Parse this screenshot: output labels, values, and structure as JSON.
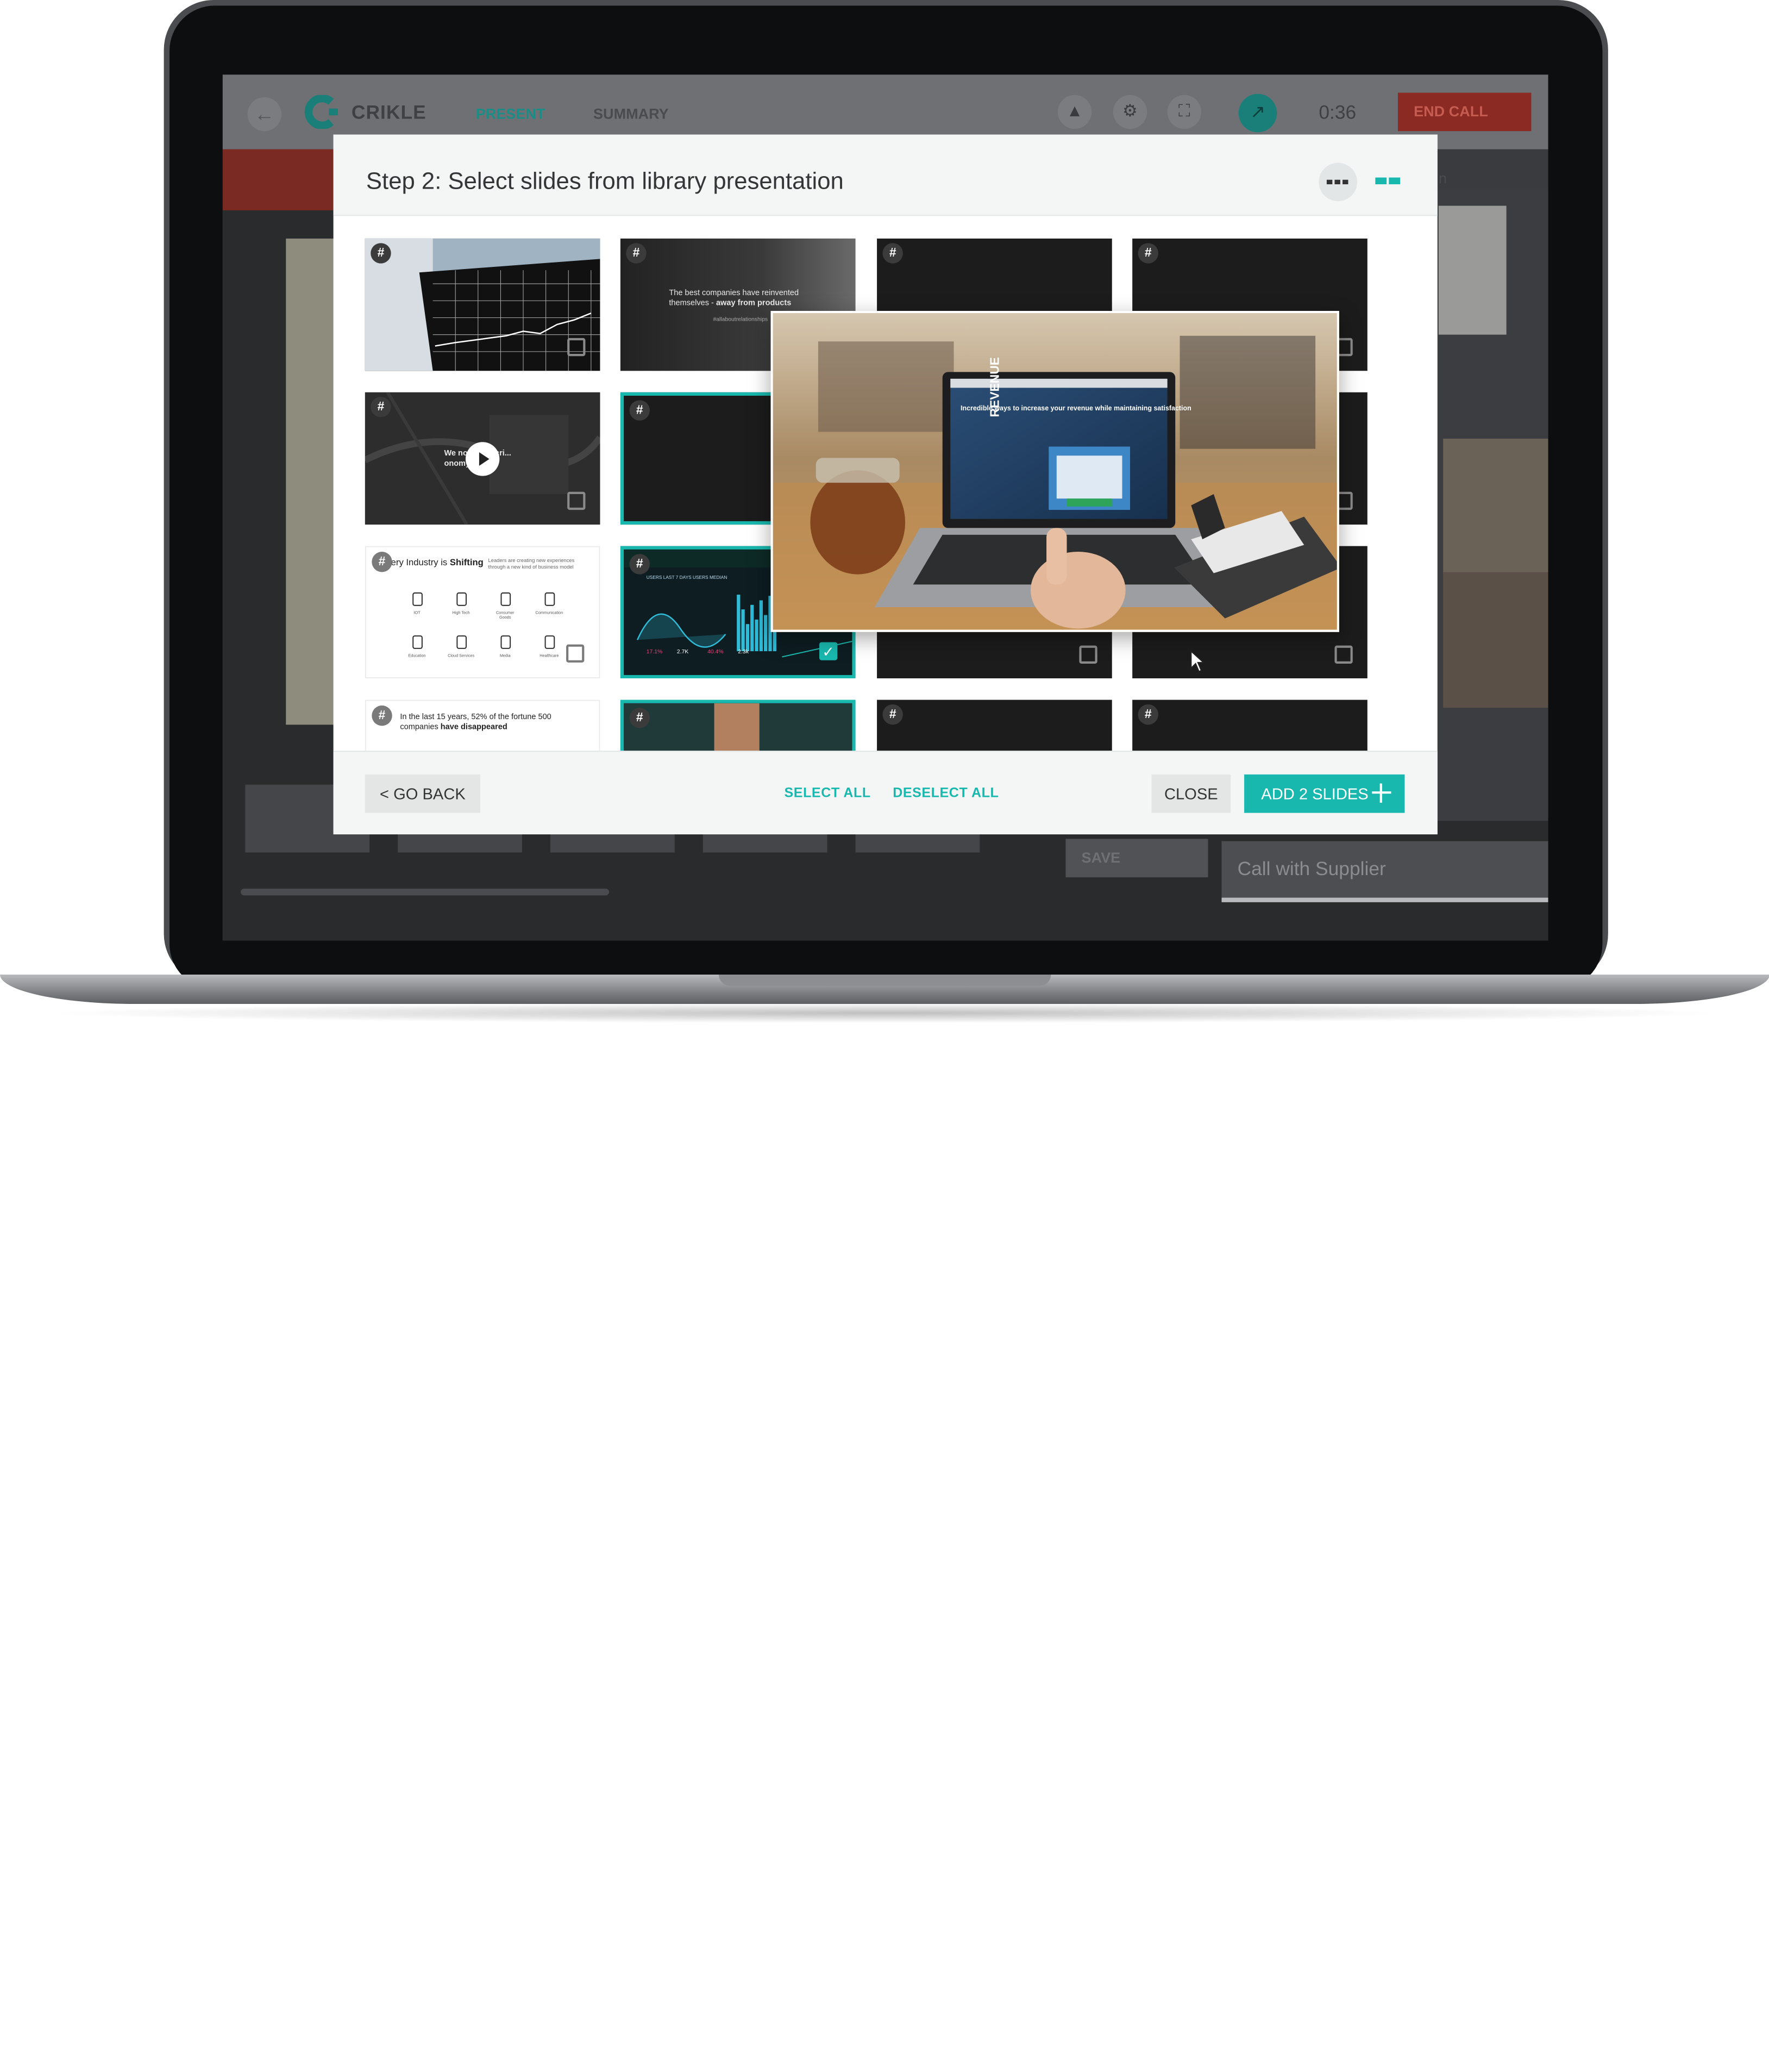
{
  "app": {
    "brand": "CRIKLE",
    "tabs": [
      "PRESENT",
      "SUMMARY"
    ],
    "timer": "0:36",
    "end_call": "END CALL",
    "save": "SAVE",
    "call_title": "Call with Supplier",
    "right_label": "n",
    "accent": "#19b8ae"
  },
  "modal": {
    "title": "Step 2: Select slides from library presentation",
    "view_icons": [
      "list-view-icon",
      "grid-view-icon"
    ],
    "footer": {
      "go_back": "< GO BACK",
      "select_all": "SELECT ALL",
      "deselect_all": "DESELECT ALL",
      "close": "CLOSE",
      "add": "ADD 2 SLIDES"
    }
  },
  "tile_badge": "#",
  "slides": [
    {
      "style": "stock-chart",
      "selected": false
    },
    {
      "style": "quote",
      "selected": false,
      "text": "The best companies have reinvented themselves - away from products",
      "bold": "away from products",
      "tag": "#allaboutrelationships"
    },
    {
      "style": "dark",
      "selected": false
    },
    {
      "style": "dark",
      "selected": false
    },
    {
      "style": "map-video",
      "selected": false,
      "text": "We no... subscri... onomy"
    },
    {
      "style": "dark",
      "selected": false,
      "highlight": true
    },
    {
      "style": "dark",
      "selected": false
    },
    {
      "style": "dark",
      "selected": false
    },
    {
      "style": "industry",
      "selected": false,
      "title": "very Industry is Shifting",
      "subtitle": "Leaders are creating new experiences through a new kind of business model",
      "icons": [
        "IOT",
        "High Tech",
        "Consumer Goods",
        "Communication",
        "Education",
        "Cloud Services",
        "Media",
        "Healthcare"
      ]
    },
    {
      "style": "dashboard",
      "selected": true,
      "heading": "USERS  LAST 7 DAYS  USERS MEDIAN",
      "stats": [
        "17.1%",
        "2.7K",
        "40.4%",
        "2.3k"
      ]
    },
    {
      "style": "dark",
      "selected": false
    },
    {
      "style": "dark",
      "selected": false
    },
    {
      "style": "fortune",
      "selected": false,
      "text": "In the last 15 years, 52% of the fortune 500 companies",
      "bold": "have disappeared"
    },
    {
      "style": "photo",
      "selected": true
    },
    {
      "style": "dark",
      "selected": false
    },
    {
      "style": "dark",
      "selected": false
    }
  ],
  "preview": {
    "headline": "Incredible ways to increase your revenue while maintaining satisfaction",
    "side_word": "REVENUE"
  }
}
